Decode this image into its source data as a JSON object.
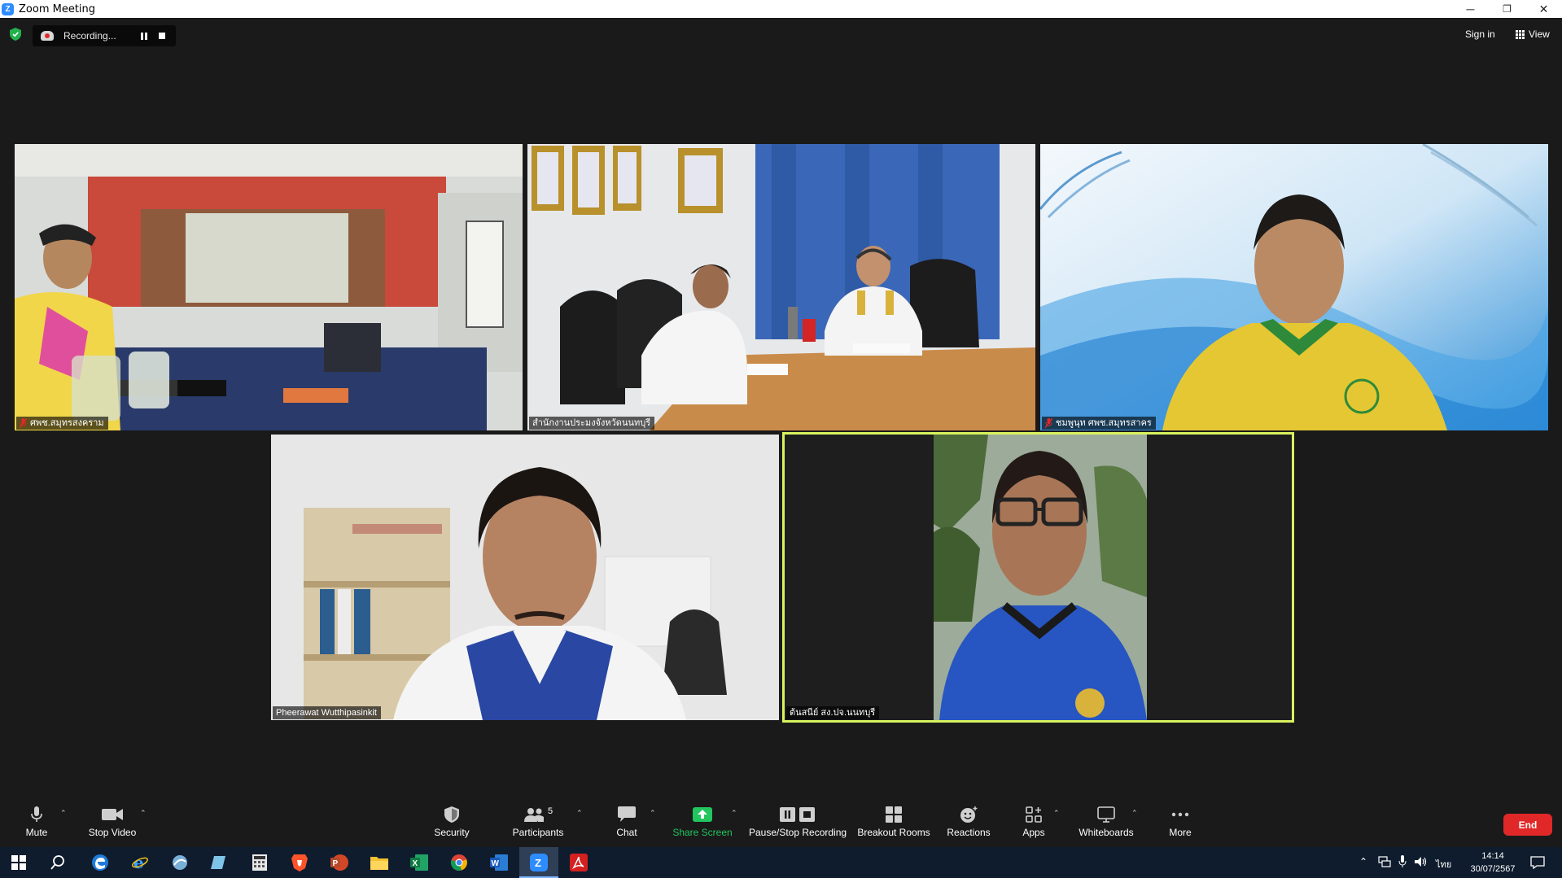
{
  "window": {
    "title": "Zoom Meeting",
    "minimize": "─",
    "restore": "❐",
    "close": "✕"
  },
  "topbar": {
    "recording_label": "Recording...",
    "sign_in": "Sign in",
    "view": "View"
  },
  "participants": [
    {
      "name": "ศพช.สมุทรสงคราม",
      "muted": true
    },
    {
      "name": "สำนักงานประมงจังหวัดนนทบุรี",
      "muted": false
    },
    {
      "name": "ชมพูนุท ศพช.สมุทรสาคร",
      "muted": true
    },
    {
      "name": "Pheerawat Wutthipasinkit",
      "muted": false
    },
    {
      "name": "ต้นสนีย์ สง.ปจ.นนทบุรี",
      "muted": false,
      "active_speaker": true
    }
  ],
  "toolbar": {
    "mute": "Mute",
    "stop_video": "Stop Video",
    "security": "Security",
    "participants": "Participants",
    "participants_count": "5",
    "chat": "Chat",
    "share_screen": "Share Screen",
    "pause_stop_recording": "Pause/Stop Recording",
    "breakout_rooms": "Breakout Rooms",
    "reactions": "Reactions",
    "apps": "Apps",
    "whiteboards": "Whiteboards",
    "more": "More",
    "end": "End"
  },
  "taskbar": {
    "time": "14:14",
    "date": "30/07/2567",
    "language": "ไทย"
  },
  "colors": {
    "active_speaker_border": "#d8f25f",
    "share_screen_green": "#22c55e",
    "end_red": "#e02828",
    "zoom_blue": "#2d8cff"
  }
}
